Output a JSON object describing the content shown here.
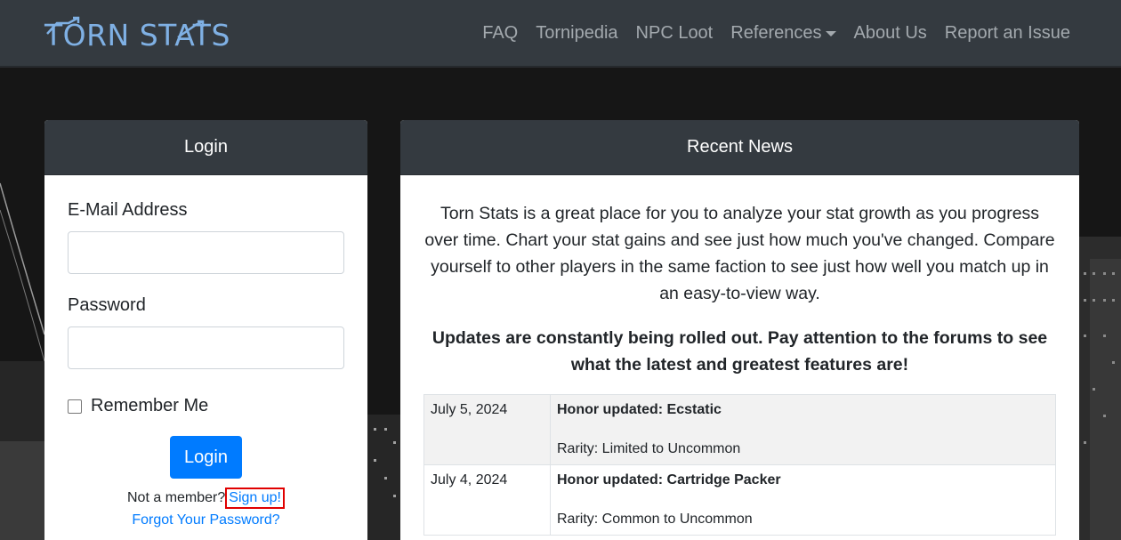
{
  "brand": {
    "name": "TORN STATS"
  },
  "nav": {
    "items": [
      {
        "label": "FAQ"
      },
      {
        "label": "Tornipedia"
      },
      {
        "label": "NPC Loot"
      },
      {
        "label": "References"
      },
      {
        "label": "About Us"
      },
      {
        "label": "Report an Issue"
      }
    ]
  },
  "login": {
    "header": "Login",
    "email_label": "E-Mail Address",
    "email_value": "",
    "password_label": "Password",
    "password_value": "",
    "remember_label": "Remember Me",
    "remember_checked": false,
    "button_label": "Login",
    "member_text": "Not a member?",
    "signup_label": "Sign up!",
    "forgot_label": "Forgot Your Password?"
  },
  "news": {
    "header": "Recent News",
    "intro": "Torn Stats is a great place for you to analyze your stat growth as you progress over time. Chart your stat gains and see just how much you've changed. Compare yourself to other players in the same faction to see just how well you match up in an easy-to-view way.",
    "notice": "Updates are constantly being rolled out. Pay attention to the forums to see what the latest and greatest features are!",
    "rows": [
      {
        "date": "July 5, 2024",
        "title": "Honor updated: Ecstatic",
        "desc": "Rarity: Limited to Uncommon"
      },
      {
        "date": "July 4, 2024",
        "title": "Honor updated: Cartridge Packer",
        "desc": "Rarity: Common to Uncommon"
      }
    ]
  },
  "colors": {
    "navbar": "#343a40",
    "brand": "#7fb0e4",
    "primary": "#007bff",
    "highlight": "#e00000"
  }
}
